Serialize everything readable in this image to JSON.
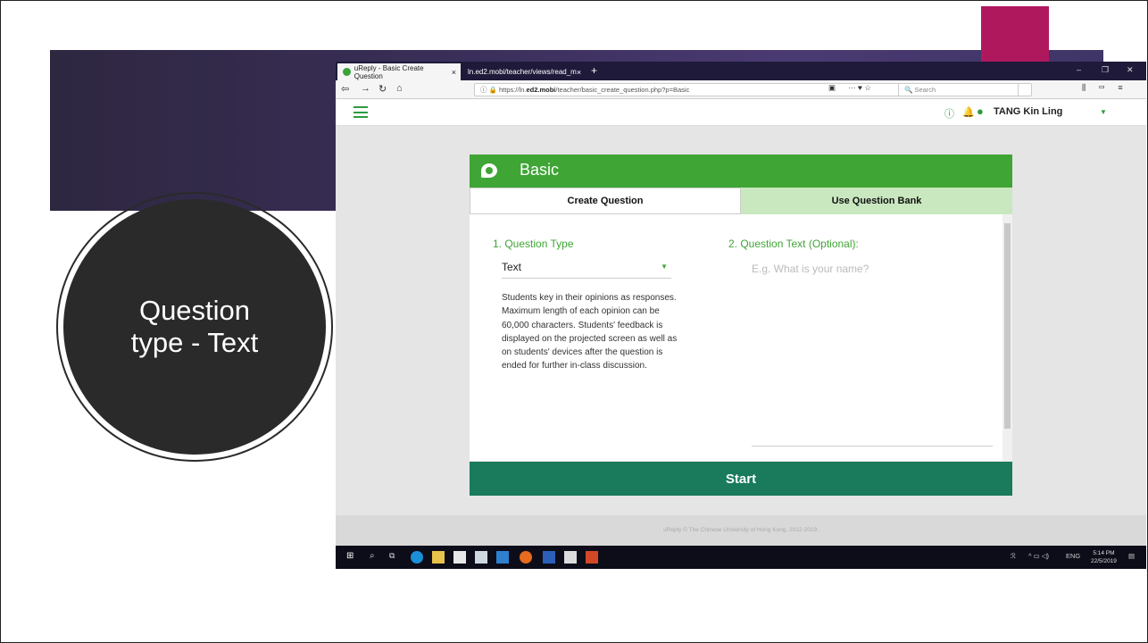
{
  "slide": {
    "title_line1": "Question",
    "title_line2": "type - Text"
  },
  "browser": {
    "tabs": [
      {
        "label": "uReply - Basic Create Question",
        "close": "×"
      },
      {
        "label": "ln.ed2.mobi/teacher/views/read_m",
        "close": "×"
      }
    ],
    "new_tab": "+",
    "url_prefix": "https://ln.",
    "url_domain": "ed2.mobi",
    "url_path": "/teacher/basic_create_question.php?p=Basic",
    "search_placeholder": "Search",
    "window_controls": [
      "–",
      "❐",
      "✕"
    ]
  },
  "app": {
    "user_name": "TANG Kin Ling",
    "card_title": "Basic",
    "tabs": [
      "Create Question",
      "Use Question Bank"
    ],
    "question_type_label": "1. Question Type",
    "question_type_value": "Text",
    "description": "Students key in their opinions as responses. Maximum length of each opinion can be 60,000 characters. Students' feedback is displayed on the projected screen as well as on students' devices after the question is ended for further in-class discussion.",
    "question_text_label": "2. Question Text (Optional):",
    "question_text_placeholder": "E.g. What is your name?",
    "start_label": "Start",
    "footer": "uReply © The Chinese University of Hong Kong, 2012-2019."
  },
  "taskbar": {
    "tray_text": "ENG",
    "time": "5:14 PM",
    "date": "22/5/2019"
  },
  "colors": {
    "green": "#3fa535",
    "dark_green": "#197a5c",
    "light_green": "#c9e8bf",
    "magenta": "#b0185e",
    "banner": "#3a2f5a",
    "circle": "#2a2a2a"
  }
}
